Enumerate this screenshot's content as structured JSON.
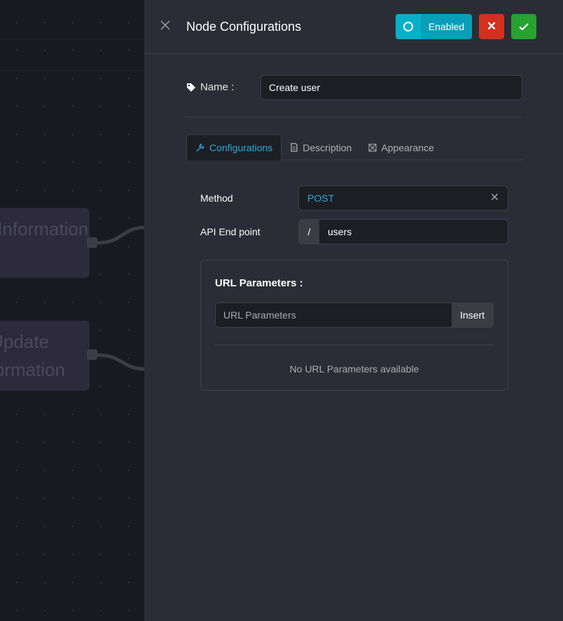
{
  "canvas": {
    "nodes": [
      {
        "label": "Save Information"
      },
      {
        "label": "Update Information"
      }
    ]
  },
  "panel": {
    "title": "Node Configurations",
    "enabled_label": "Enabled",
    "enabled": false,
    "name_label": "Name :",
    "name_value": "Create user",
    "tabs": [
      {
        "label": "Configurations",
        "icon": "wrench-icon",
        "active": true
      },
      {
        "label": "Description",
        "icon": "document-icon"
      },
      {
        "label": "Appearance",
        "icon": "palette-icon"
      }
    ],
    "method_label": "Method",
    "method_value": "POST",
    "endpoint_label": "API End point",
    "endpoint_prefix": "/",
    "endpoint_value": "users",
    "url_params": {
      "title": "URL Parameters :",
      "placeholder": "URL Parameters",
      "insert_label": "Insert",
      "empty_text": "No URL Parameters available"
    }
  },
  "colors": {
    "accent": "#2eaadc",
    "enabled": "#0a9fb8",
    "cancel": "#d3301f",
    "confirm": "#28a130"
  }
}
